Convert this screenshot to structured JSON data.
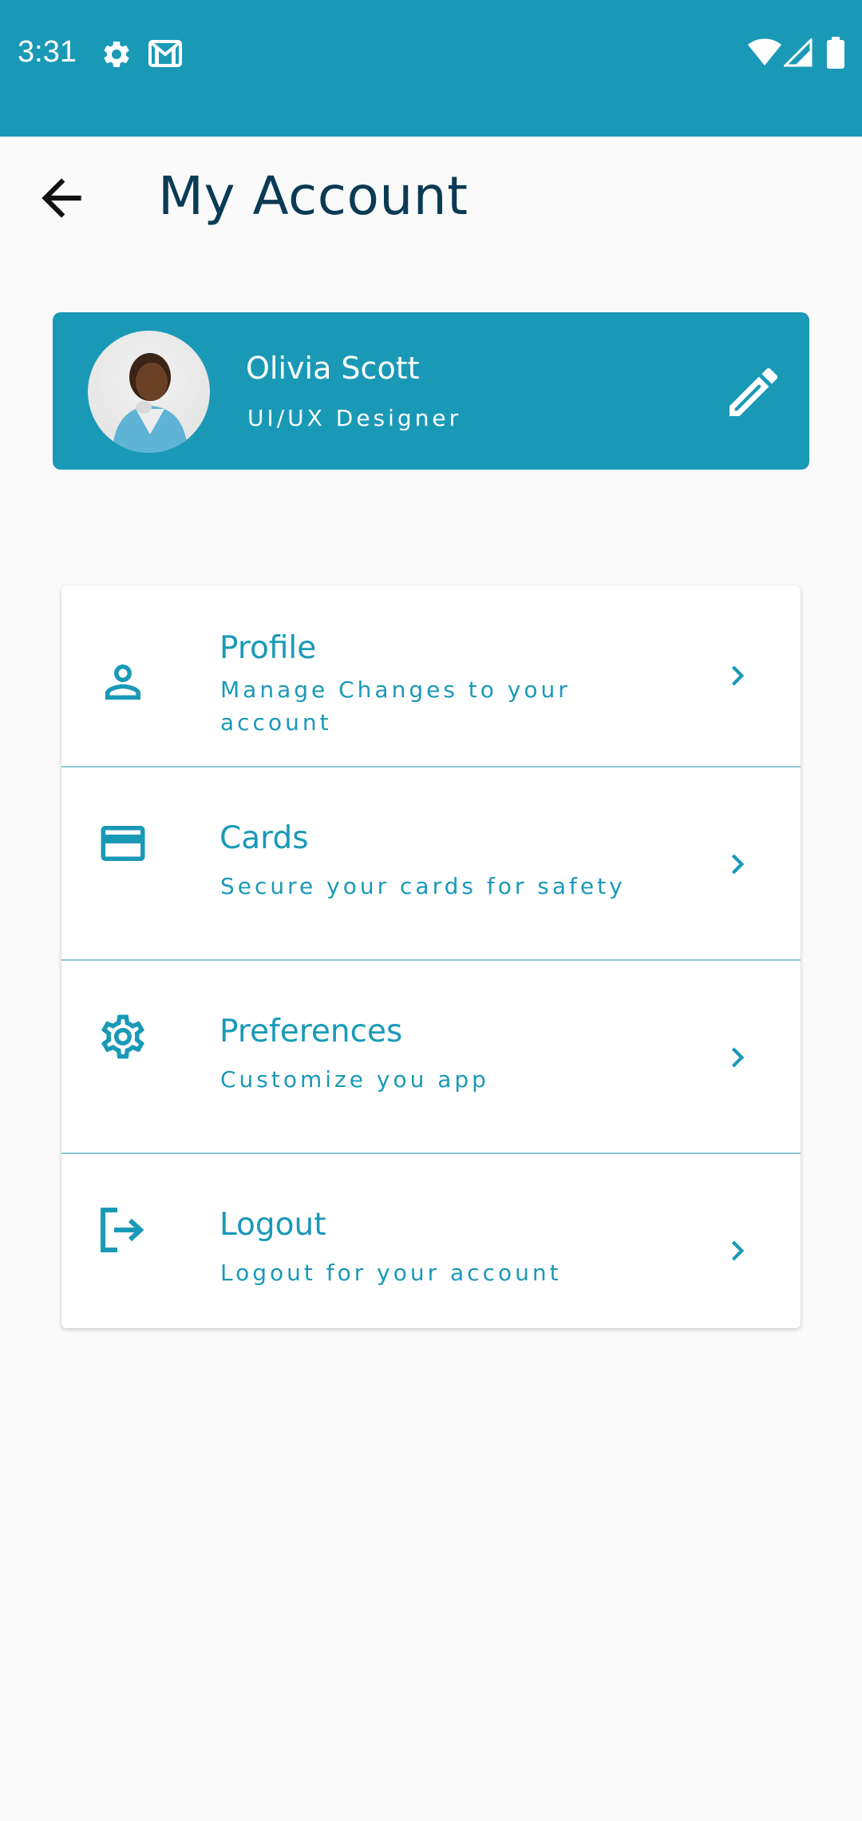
{
  "status_bar": {
    "time": "3:31",
    "left_icons": [
      "gear-icon",
      "gmail-icon"
    ],
    "right_icons": [
      "wifi-icon",
      "signal-icon",
      "battery-icon"
    ],
    "color": "#1A99B7"
  },
  "app_bar": {
    "title": "My Account",
    "back_icon": "arrow-left-icon"
  },
  "profile": {
    "name": "Olivia Scott",
    "role": "UI/UX Designer",
    "edit_icon": "pencil-icon",
    "avatar": "avatar-photo"
  },
  "menu": {
    "items": [
      {
        "title": "Profile",
        "subtitle": "Manage Changes to your account",
        "icon": "person-icon"
      },
      {
        "title": "Cards",
        "subtitle": "Secure your cards for safety",
        "icon": "credit-card-icon"
      },
      {
        "title": "Preferences",
        "subtitle": "Customize you app",
        "icon": "settings-icon"
      },
      {
        "title": "Logout",
        "subtitle": "Logout for your account",
        "icon": "logout-icon"
      }
    ],
    "chevron_icon": "chevron-right-icon"
  },
  "colors": {
    "accent": "#1A99B7",
    "title": "#0B3B54",
    "background": "#FAFAFA"
  }
}
